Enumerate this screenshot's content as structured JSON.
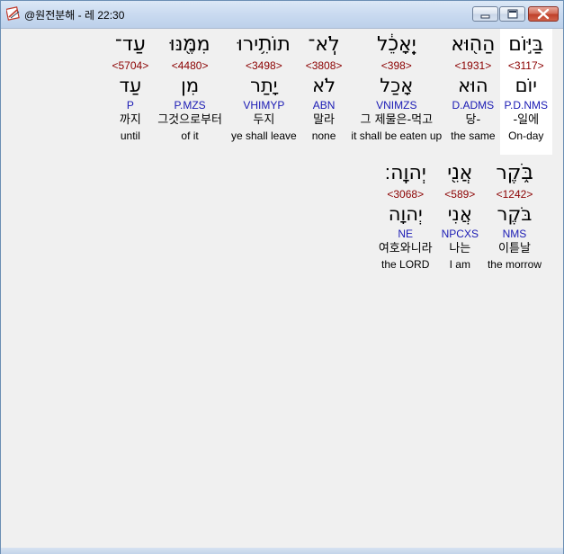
{
  "window": {
    "title": "@원전분해 - 레 22:30"
  },
  "icons": {
    "app": "app-icon",
    "minimize": "minimize-icon",
    "maximize": "maximize-icon",
    "close": "close-icon"
  },
  "rows": [
    {
      "words": [
        {
          "hebrew": "בַּיּ֣וֹם",
          "strong": "<3117>",
          "root": "יוֹם",
          "morph": "P.D.NMS",
          "korean": "-일에",
          "english": "On-day",
          "current": true
        },
        {
          "hebrew": "הַה֖וּא",
          "strong": "<1931>",
          "root": "הוּא",
          "morph": "D.ADMS",
          "korean": "당-",
          "english": "the same",
          "current": false
        },
        {
          "hebrew": "יֵֽאָכֵ֔ל",
          "strong": "<398>",
          "root": "אָכַל",
          "morph": "VNIMZS",
          "korean": "그 제물은-먹고",
          "english": "it shall be eaten up",
          "current": false
        },
        {
          "hebrew": "לֹֽא־",
          "strong": "<3808>",
          "root": "לֹא",
          "morph": "ABN",
          "korean": "말라",
          "english": "none",
          "current": false
        },
        {
          "hebrew": "תוֹתִ֥ירוּ",
          "strong": "<3498>",
          "root": "יָתַר",
          "morph": "VHIMYP",
          "korean": "두지",
          "english": "ye shall leave",
          "current": false
        },
        {
          "hebrew": "מִמֶּ֖נּוּ",
          "strong": "<4480>",
          "root": "מִן",
          "morph": "P.MZS",
          "korean": "그것으로부터",
          "english": "of it",
          "current": false
        },
        {
          "hebrew": "עַד־",
          "strong": "<5704>",
          "root": "עַד",
          "morph": "P",
          "korean": "까지",
          "english": "until",
          "current": false
        }
      ]
    },
    {
      "words": [
        {
          "hebrew": "בֹּ֑קֶר",
          "strong": "<1242>",
          "root": "בֹּקֶר",
          "morph": "NMS",
          "korean": "이튿날",
          "english": "the morrow",
          "current": false
        },
        {
          "hebrew": "אֲנִ֖י",
          "strong": "<589>",
          "root": "אֲנִי",
          "morph": "NPCXS",
          "korean": "나는",
          "english": "I am",
          "current": false
        },
        {
          "hebrew": "יְהוָֽה׃",
          "strong": "<3068>",
          "root": "יְהוָה",
          "morph": "NE",
          "korean": "여호와니라",
          "english": "the LORD",
          "current": false
        }
      ]
    }
  ]
}
